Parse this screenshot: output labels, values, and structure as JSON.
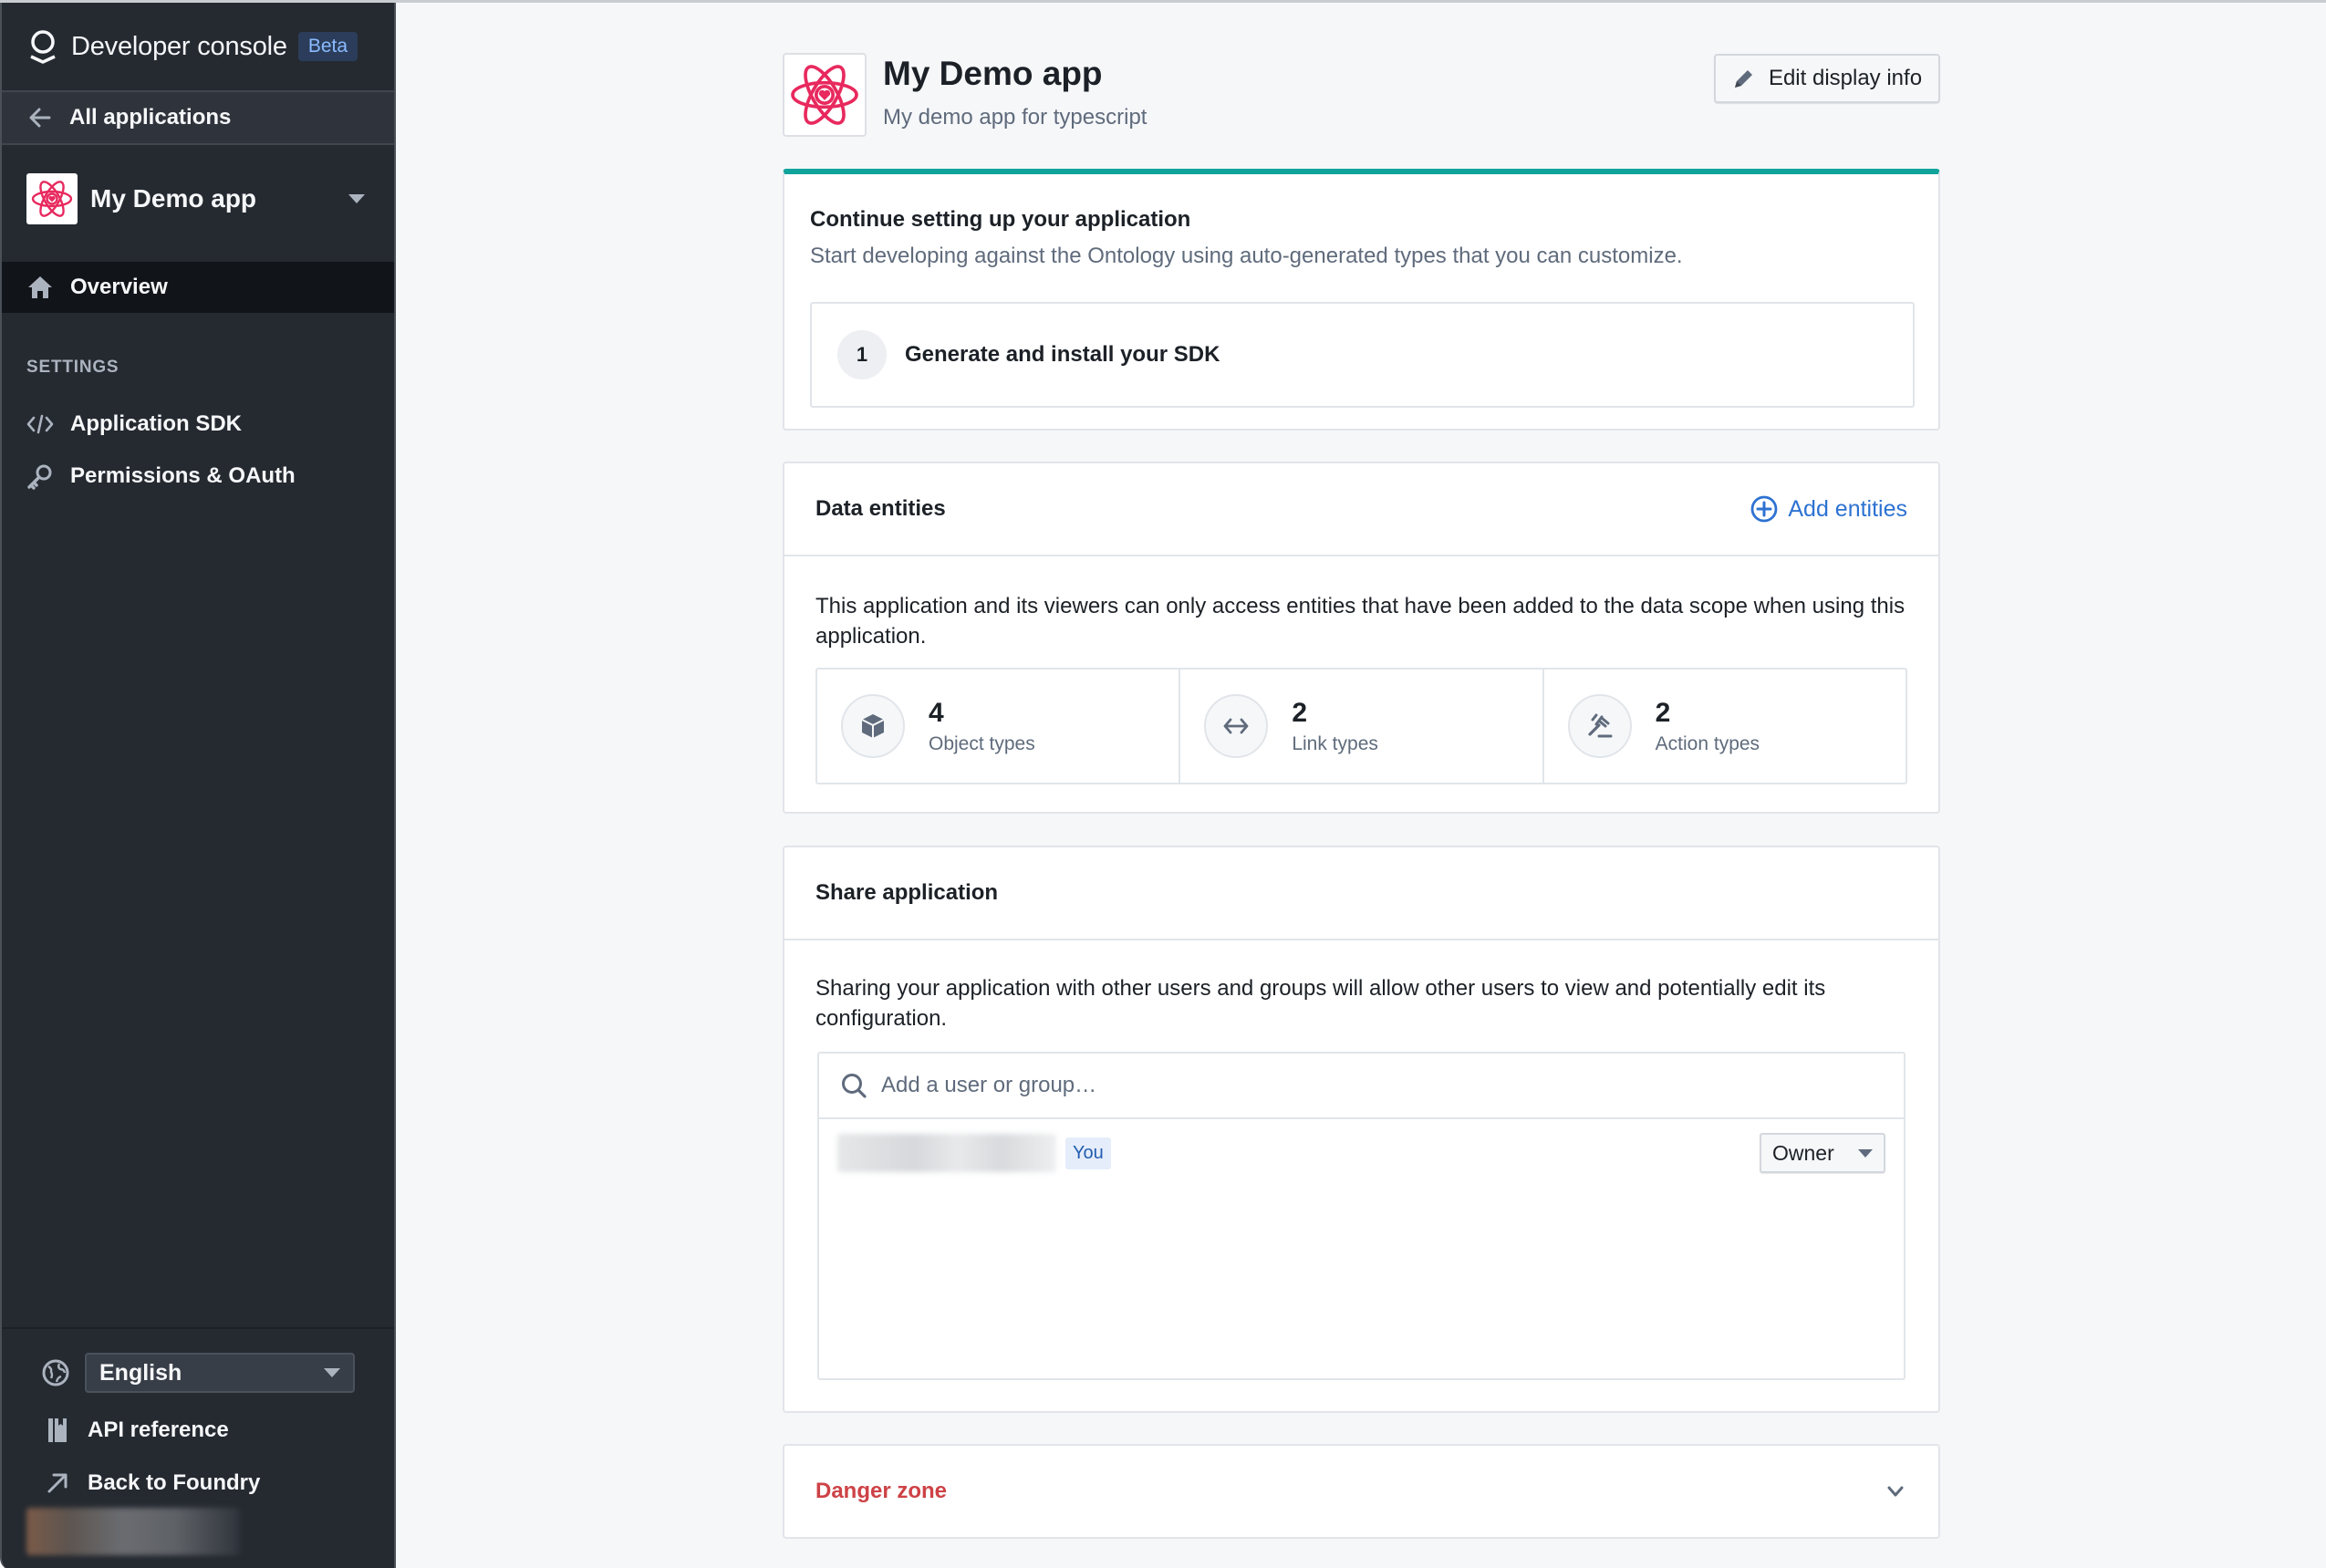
{
  "sidebar": {
    "brand": {
      "title": "Developer console",
      "badge": "Beta",
      "icon": "palantir-logo-icon"
    },
    "back": {
      "label": "All applications",
      "icon": "arrow-left-icon"
    },
    "app_selector": {
      "label": "My Demo app",
      "icon": "atom-heart-icon"
    },
    "nav": [
      {
        "label": "Overview",
        "icon": "home-icon",
        "active": true
      }
    ],
    "settings_heading": "SETTINGS",
    "settings": [
      {
        "label": "Application SDK",
        "icon": "code-icon"
      },
      {
        "label": "Permissions & OAuth",
        "icon": "key-icon"
      }
    ],
    "footer": {
      "language": {
        "selected": "English",
        "icon": "globe-icon"
      },
      "links": [
        {
          "label": "API reference",
          "icon": "book-icon"
        },
        {
          "label": "Back to Foundry",
          "icon": "arrow-top-right-icon"
        }
      ]
    }
  },
  "header": {
    "app_name": "My Demo app",
    "app_description": "My demo app for typescript",
    "edit_button": "Edit display info"
  },
  "setup_card": {
    "title": "Continue setting up your application",
    "subtitle": "Start developing against the Ontology using auto-generated types that you can customize.",
    "steps": [
      {
        "number": "1",
        "label": "Generate and install your SDK"
      }
    ]
  },
  "data_entities": {
    "title": "Data entities",
    "add_button": "Add entities",
    "description": "This application and its viewers can only access entities that have been added to the data scope when using this application.",
    "stats": [
      {
        "count": "4",
        "label": "Object types",
        "icon": "cube-icon"
      },
      {
        "count": "2",
        "label": "Link types",
        "icon": "arrows-horizontal-icon"
      },
      {
        "count": "2",
        "label": "Action types",
        "icon": "gavel-icon"
      }
    ]
  },
  "share": {
    "title": "Share application",
    "description": "Sharing your application with other users and groups will allow other users to view and potentially edit its configuration.",
    "search_placeholder": "Add a user or group…",
    "members": [
      {
        "name": "[redacted]",
        "badge": "You",
        "role": "Owner"
      }
    ]
  },
  "danger_zone": {
    "title": "Danger zone",
    "expanded": false
  },
  "colors": {
    "sidebar_bg": "#252a31",
    "active_item_bg": "#111418",
    "accent_teal": "#0fa39b",
    "link_blue": "#2d72d2",
    "danger_red": "#cd4246",
    "page_bg": "#f6f7f9"
  }
}
